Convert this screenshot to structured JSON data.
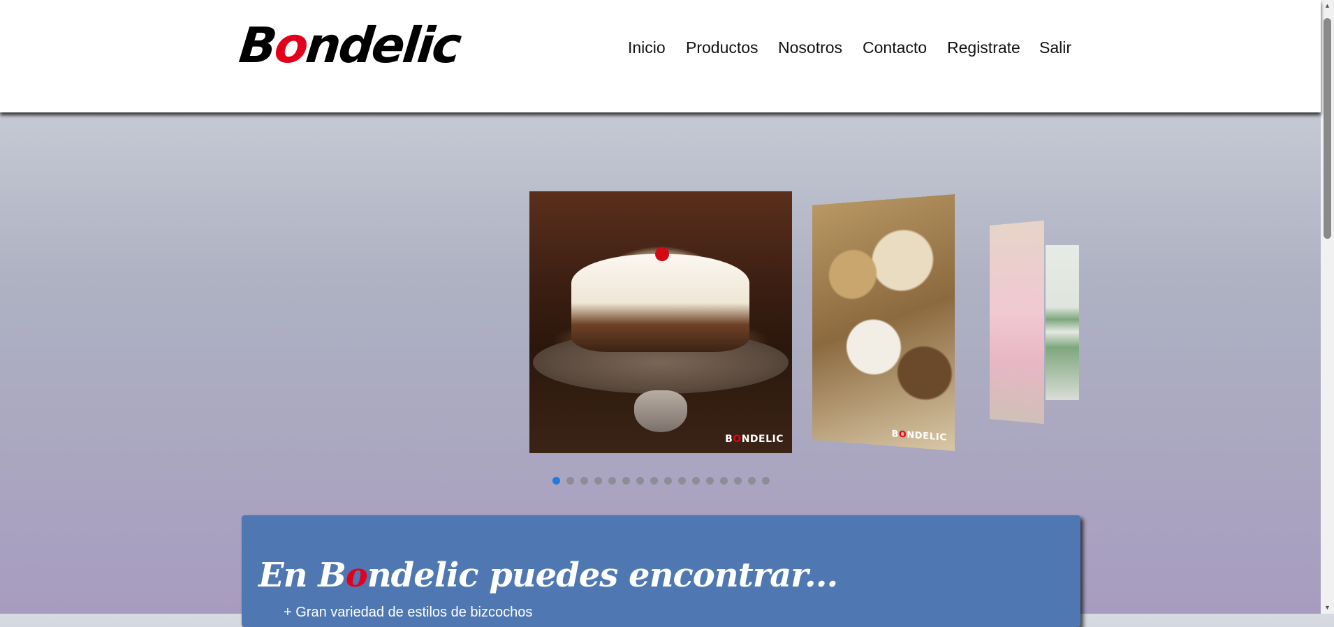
{
  "header": {
    "logo": {
      "before": "B",
      "highlight": "o",
      "after": "ndelic"
    },
    "nav": [
      {
        "label": "Inicio"
      },
      {
        "label": "Productos"
      },
      {
        "label": "Nosotros"
      },
      {
        "label": "Contacto"
      },
      {
        "label": "Registrate"
      },
      {
        "label": "Salir"
      }
    ]
  },
  "carousel": {
    "brand_watermark": {
      "before": "B",
      "highlight": "O",
      "after": "NDELIC"
    },
    "slides": [
      {
        "subject": "cake-on-stand"
      },
      {
        "subject": "assorted-savory-bites"
      },
      {
        "subject": "pink-birthday-cake"
      },
      {
        "subject": "printed-menu-card"
      }
    ],
    "dot_count": 16,
    "active_index": 0
  },
  "info": {
    "title": {
      "before": "En B",
      "highlight": "o",
      "after": "ndelic puedes encontrar..."
    },
    "items": [
      "Gran variedad de estilos de bizcochos"
    ]
  },
  "colors": {
    "accent_red": "#e4001b",
    "panel_blue": "#4f78b3",
    "active_dot": "#1f7be0"
  }
}
